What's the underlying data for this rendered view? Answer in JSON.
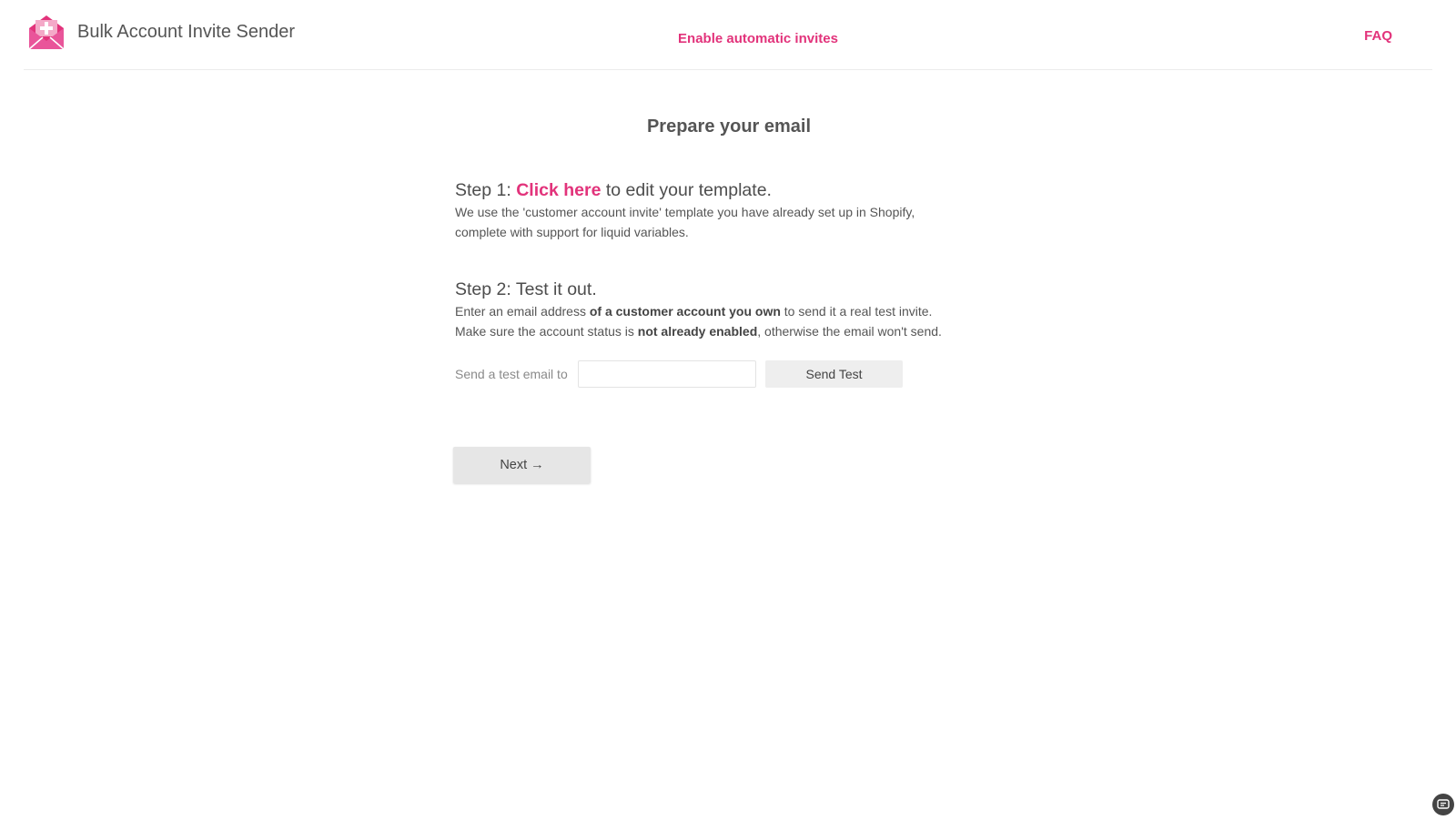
{
  "header": {
    "app_title": "Bulk Account Invite Sender",
    "logo_icon": "envelope-plus-icon",
    "nav_auto_label": "Enable automatic invites",
    "nav_faq_label": "FAQ",
    "accent_color": "#e2337b"
  },
  "main": {
    "title": "Prepare your email",
    "step1": {
      "prefix": "Step 1:",
      "link_label": "Click here",
      "suffix": "to edit your template.",
      "line1": "We use the 'customer account invite' template you have already set up in Shopify,",
      "line2": "complete with support for liquid variables."
    },
    "step2": {
      "heading": "Step 2: Test it out.",
      "line1_a": "Enter an email address",
      "line1_b": "of a customer account you own",
      "line1_c": "to send it a real test invite.",
      "line2_a": "Make sure the account status is",
      "line2_b": "not already enabled",
      "line2_c": ", otherwise the email won't send."
    },
    "test_email": {
      "label": "Send a test email to",
      "value": "",
      "button_label": "Send Test"
    },
    "next_label": "Next →"
  },
  "corner_widget_icon": "chat-icon"
}
